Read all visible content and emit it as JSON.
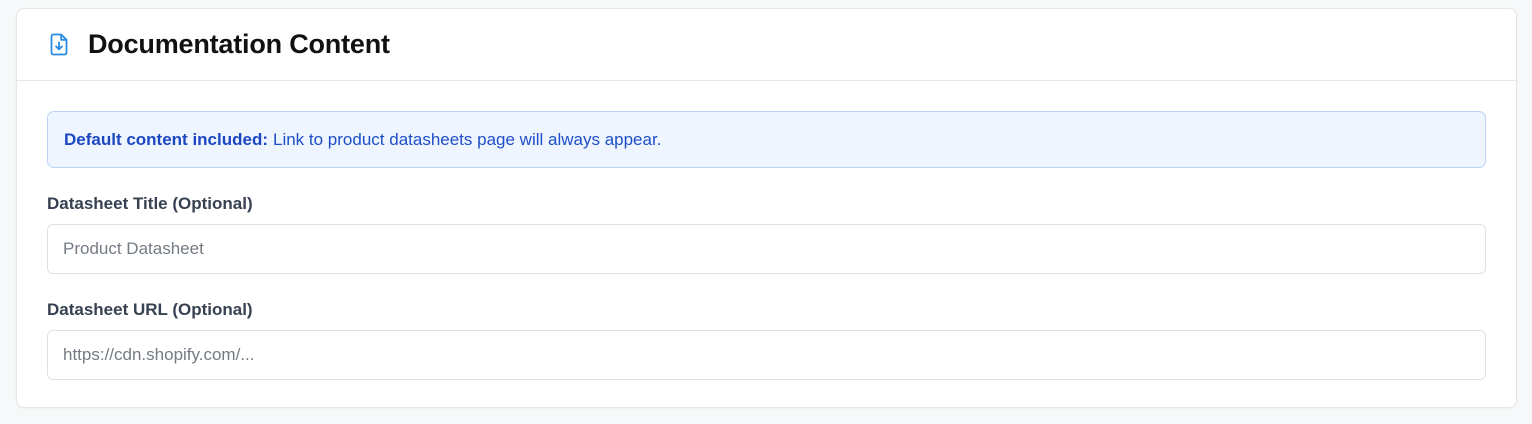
{
  "section": {
    "title": "Documentation Content",
    "icon": "file-download-icon",
    "accent_color": "#2b8ae2"
  },
  "info": {
    "strong": "Default content included:",
    "text": "Link to product datasheets page will always appear.",
    "background": "#eef5fe",
    "text_color": "#1e4fc9"
  },
  "fields": {
    "datasheet_title": {
      "label": "Datasheet Title (Optional)",
      "placeholder": "Product Datasheet",
      "value": ""
    },
    "datasheet_url": {
      "label": "Datasheet URL (Optional)",
      "placeholder": "https://cdn.shopify.com/...",
      "value": ""
    }
  }
}
